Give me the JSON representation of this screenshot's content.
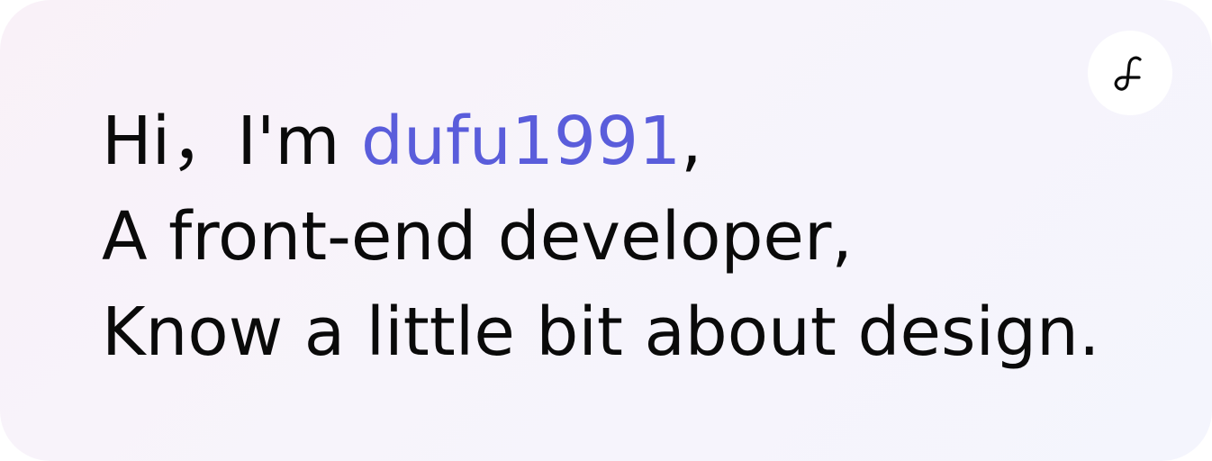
{
  "intro": {
    "greeting": "Hi，",
    "im": "I'm ",
    "name": "dufu1991",
    "name_suffix": ",",
    "line2": "A front-end developer,",
    "line3": "Know a little bit about design."
  },
  "logo": {
    "icon": "dufu-logo-icon"
  },
  "colors": {
    "accent": "#5a5ddb",
    "text": "#0a0a0a",
    "badge_bg": "#ffffff"
  }
}
